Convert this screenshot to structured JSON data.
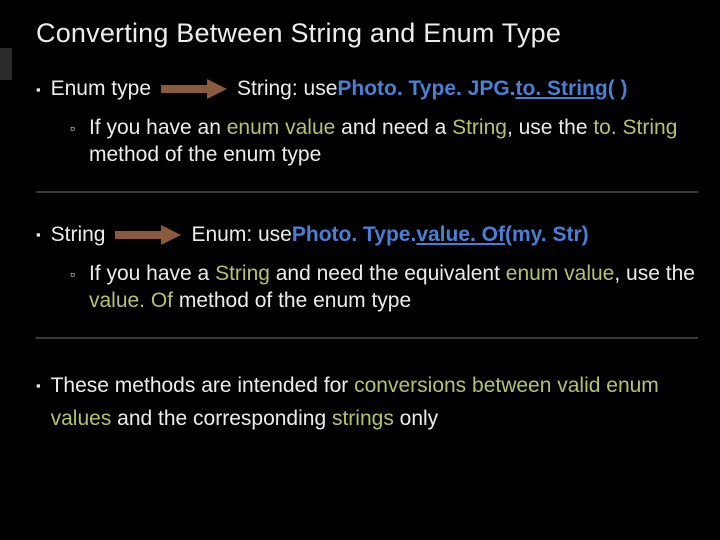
{
  "slide": {
    "title": "Converting Between String and Enum Type",
    "b1": {
      "left": "Enum type",
      "right_pre": "String: use  ",
      "code_plain": "Photo. Type. JPG. ",
      "code_u": "to. String",
      "code_tail": " ( )"
    },
    "s1": {
      "pre": "If you have an ",
      "olive1": "enum value",
      "mid1": " and need a ",
      "olive2": "String",
      "mid2": ", use the ",
      "olive3": "to. String",
      "tail": " method of the enum type"
    },
    "b2": {
      "left": "String",
      "right_pre": "Enum:  use  ",
      "code_plain": "Photo. Type. ",
      "code_u": "value. Of",
      "code_tail": " (my. Str)"
    },
    "s2": {
      "pre": "If you have a ",
      "olive1": "String",
      "mid1": " and need the equivalent ",
      "olive2": "enum value",
      "mid2": ", use the ",
      "olive3": "value. Of",
      "tail": " method of the enum type"
    },
    "b3": {
      "pre": "These methods are intended for ",
      "olive1": "conversions between valid enum values",
      "mid": " and the corresponding ",
      "olive2": "strings",
      "tail": " only"
    }
  }
}
